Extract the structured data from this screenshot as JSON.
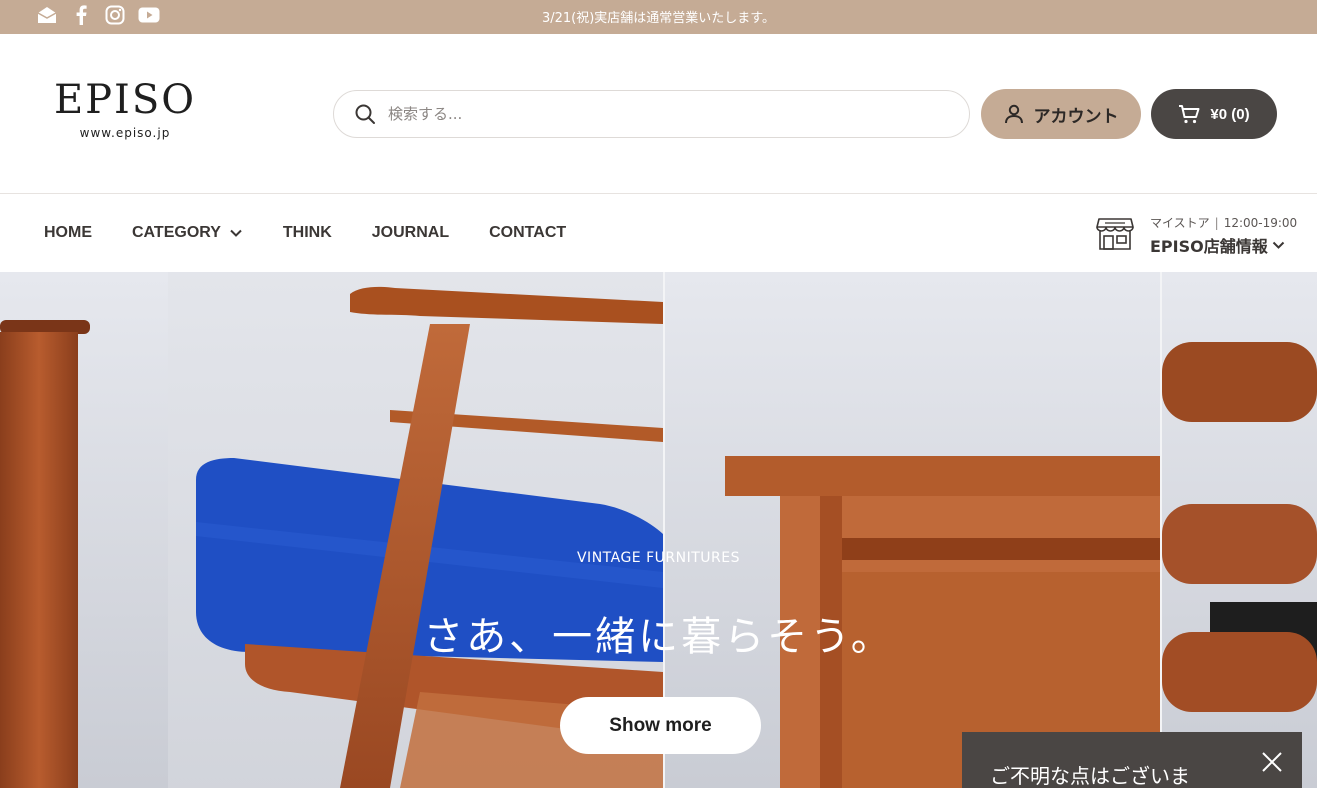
{
  "topbar": {
    "announcement": "3/21(祝)実店舗は通常営業いたします。",
    "socials": [
      "mail-icon",
      "facebook-icon",
      "instagram-icon",
      "youtube-icon"
    ],
    "bg_color": "#c5ab95"
  },
  "header": {
    "logo_brand": "EPISO",
    "logo_url": "www.episo.jp",
    "search_placeholder": "検索する...",
    "account_label": "アカウント",
    "cart_label": "¥0 (0)",
    "account_color": "#c5ab95",
    "cart_color": "#4a4644"
  },
  "nav": {
    "items": [
      {
        "label": "HOME"
      },
      {
        "label": "CATEGORY"
      },
      {
        "label": "THINK"
      },
      {
        "label": "JOURNAL"
      },
      {
        "label": "CONTACT"
      }
    ],
    "store": {
      "label": "マイストア",
      "hours": "12:00-19:00",
      "name": "EPISO店舗情報"
    }
  },
  "hero": {
    "eyebrow": "VINTAGE FURNITURES",
    "headline": "さあ、一緒に暮らそう。",
    "cta": "Show more"
  },
  "chat": {
    "message": "ご不明な点はございま"
  }
}
